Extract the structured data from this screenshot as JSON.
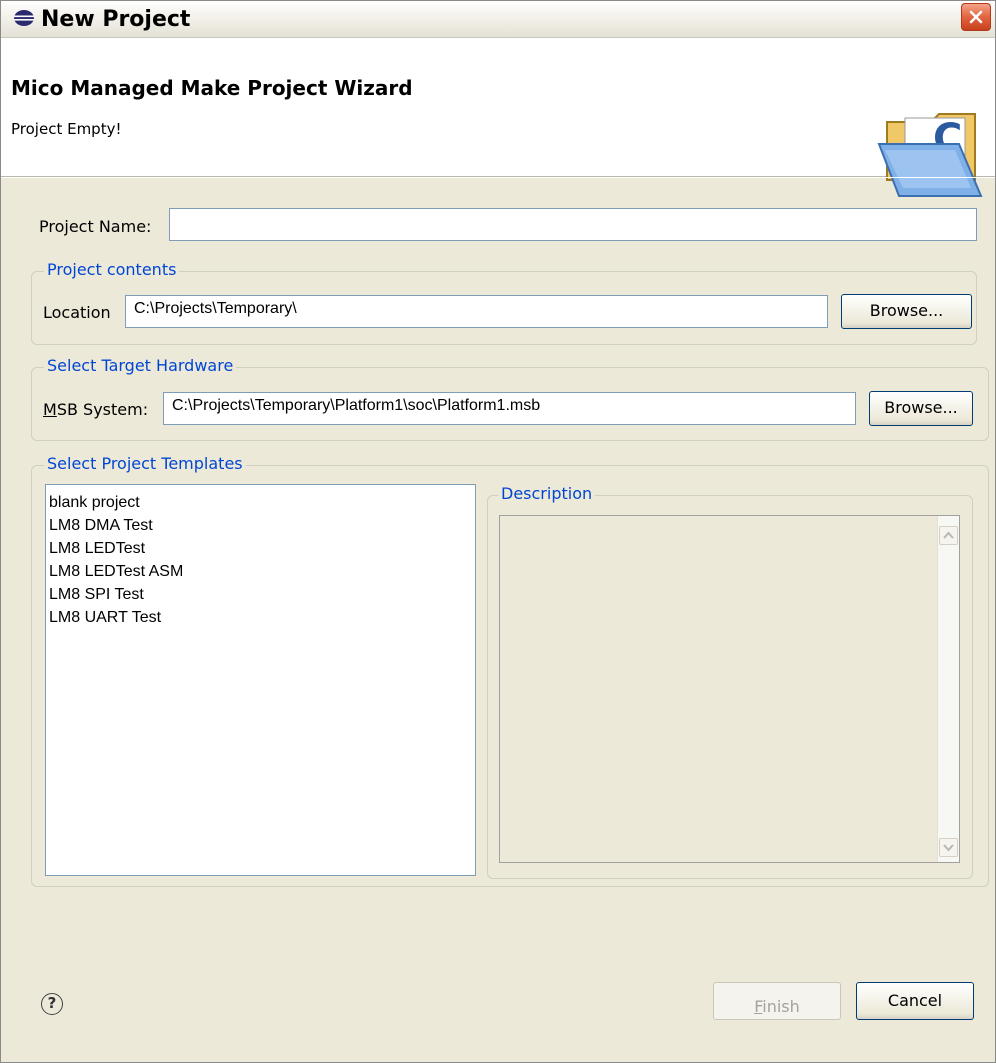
{
  "window": {
    "title": "New Project",
    "title_icon": "eclipse-icon",
    "close_icon": "close-icon"
  },
  "banner": {
    "title": "Mico Managed Make Project Wizard",
    "message": "Project Empty!",
    "icon": "c-project-folder-icon"
  },
  "form": {
    "project_name_label": "Project Name:",
    "project_name_value": "",
    "contents_group": {
      "legend": "Project contents",
      "location_label": "Location",
      "location_value": "C:\\Projects\\Temporary\\",
      "browse_label": "Browse..."
    },
    "target_group": {
      "legend": "Select Target Hardware",
      "msb_label_mnemonic": "M",
      "msb_label_rest": "SB System:",
      "msb_value": "C:\\Projects\\Temporary\\Platform1\\soc\\Platform1.msb",
      "browse_label": "Browse..."
    },
    "templates_group": {
      "legend": "Select Project Templates",
      "items": [
        "blank project",
        "LM8 DMA Test",
        "LM8 LEDTest",
        "LM8 LEDTest ASM",
        "LM8 SPI Test",
        "LM8 UART Test"
      ],
      "description_legend": "Description",
      "description_text": ""
    }
  },
  "footer": {
    "help_icon": "help-icon",
    "help_glyph": "?",
    "finish_mnemonic": "F",
    "finish_rest": "inish",
    "cancel_label": "Cancel"
  },
  "colors": {
    "legend_blue": "#0046d5",
    "dialog_bg": "#ece9d8",
    "close_red": "#e2643f"
  }
}
